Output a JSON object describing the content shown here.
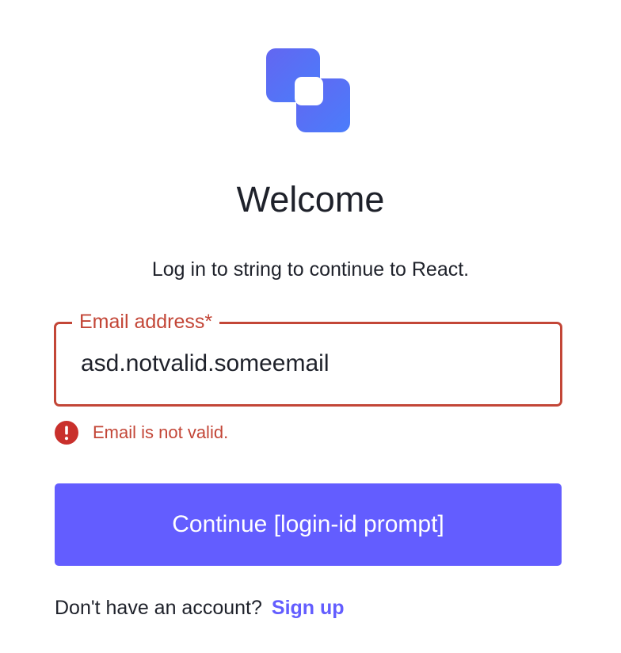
{
  "brand": {
    "logo_icon": "app-logo-icon",
    "color_primary": "#635dff",
    "color_logo_start": "#6366f1",
    "color_logo_end": "#4a7dfb"
  },
  "header": {
    "title": "Welcome",
    "subtitle": "Log in to string to continue to React."
  },
  "form": {
    "email": {
      "label": "Email address*",
      "value": "asd.notvalid.someemail",
      "error_message": "Email is not valid.",
      "error_icon": "error-alert-icon",
      "error_color": "#c34637"
    },
    "continue_label": "Continue [login-id prompt]"
  },
  "footer": {
    "prompt": "Don't have an account?",
    "signup_label": "Sign up"
  }
}
